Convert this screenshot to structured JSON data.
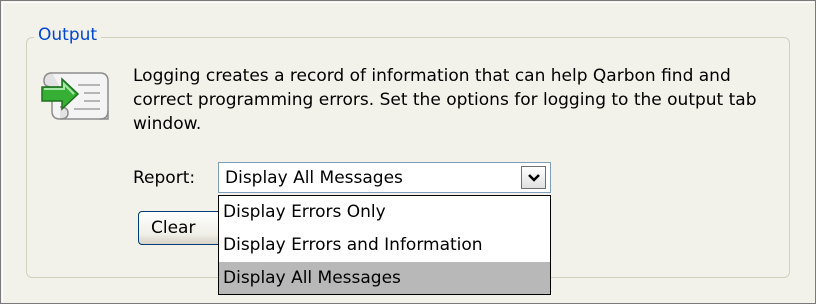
{
  "group": {
    "title": "Output"
  },
  "description": "Logging creates a record of information that can help Qarbon find and correct programming errors. Set the options for logging to the output  tab window.",
  "report": {
    "label": "Report:",
    "selected": "Display All Messages",
    "options": [
      "Display Errors Only",
      "Display Errors and Information",
      "Display All Messages"
    ],
    "highlighted_index": 2
  },
  "buttons": {
    "clear_label": "Clear"
  },
  "icons": {
    "logging": "scroll-arrow-icon",
    "dropdown": "chevron-down-icon"
  },
  "colors": {
    "legend": "#0046d5",
    "highlight": "#b8b8b8"
  }
}
